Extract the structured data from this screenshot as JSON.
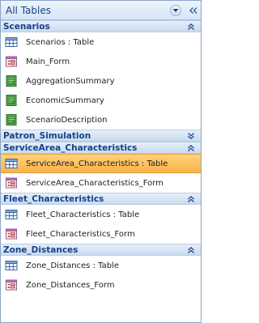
{
  "header": {
    "title": "All Tables",
    "dropdown_icon": "chevron-down-icon",
    "collapse_icon": "double-chevron-left-icon"
  },
  "groups": [
    {
      "label": "Scenarios",
      "expanded": true,
      "items": [
        {
          "label": "Scenarios : Table",
          "icon": "table-icon"
        },
        {
          "label": "Main_Form",
          "icon": "form-icon"
        },
        {
          "label": "AggregationSummary",
          "icon": "report-icon"
        },
        {
          "label": "EconomicSummary",
          "icon": "report-icon"
        },
        {
          "label": "ScenarioDescription",
          "icon": "report-icon"
        }
      ]
    },
    {
      "label": "Patron_Simulation",
      "expanded": false,
      "items": []
    },
    {
      "label": "ServiceArea_Characteristics",
      "expanded": true,
      "items": [
        {
          "label": "ServiceArea_Characteristics : Table",
          "icon": "table-icon",
          "selected": true
        },
        {
          "label": "ServiceArea_Characteristics_Form",
          "icon": "form-icon"
        }
      ]
    },
    {
      "label": "Fleet_Characteristics",
      "expanded": true,
      "items": [
        {
          "label": "Fleet_Characteristics : Table",
          "icon": "table-icon"
        },
        {
          "label": "Fleet_Characteristics_Form",
          "icon": "form-icon"
        }
      ]
    },
    {
      "label": "Zone_Distances",
      "expanded": true,
      "items": [
        {
          "label": "Zone_Distances : Table",
          "icon": "table-icon"
        },
        {
          "label": "Zone_Distances_Form",
          "icon": "form-icon"
        }
      ]
    }
  ],
  "colors": {
    "group_text": "#15428b",
    "selected_bg": "#f9b24a",
    "border": "#8aa6c8"
  }
}
